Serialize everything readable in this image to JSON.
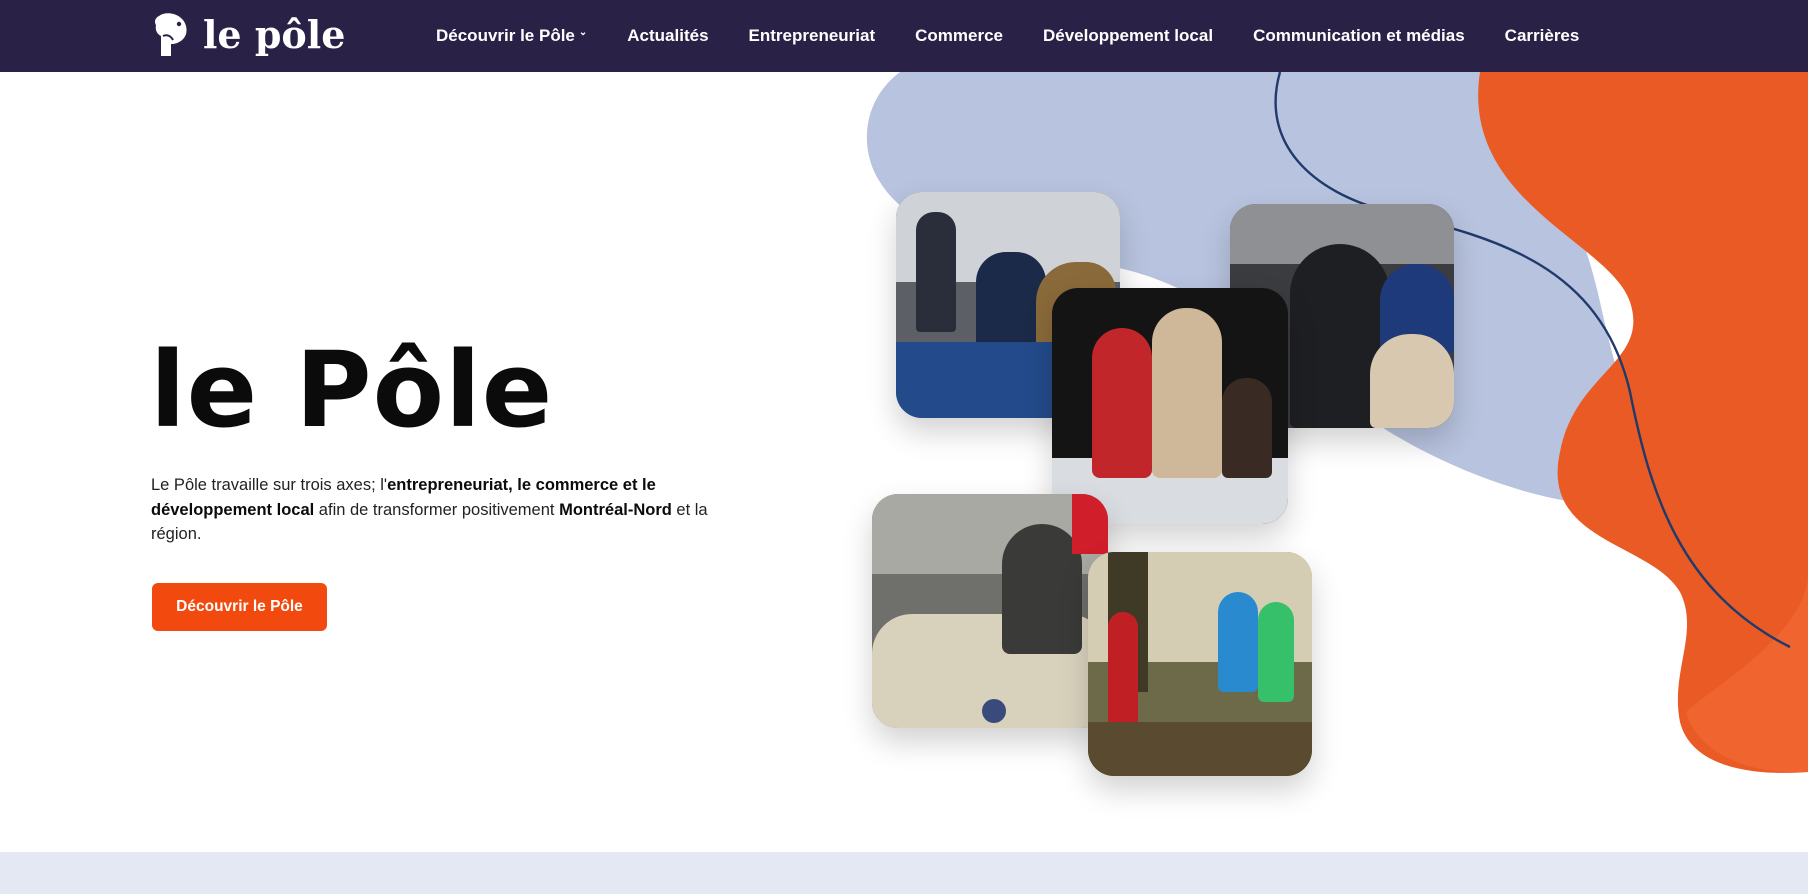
{
  "brand": {
    "name": "le pôle"
  },
  "nav": {
    "items": [
      {
        "label": "Découvrir le Pôle",
        "has_dropdown": true
      },
      {
        "label": "Actualités"
      },
      {
        "label": "Entrepreneuriat"
      },
      {
        "label": "Commerce"
      },
      {
        "label": "Développement local"
      },
      {
        "label": "Communication et médias"
      },
      {
        "label": "Carrières"
      }
    ],
    "dropdown_icon": "chevron-down-icon"
  },
  "hero": {
    "title": "le Pôle",
    "description": {
      "p1": "Le Pôle travaille sur trois axes; l'",
      "b1": "entrepreneuriat, le commerce et le développement local",
      "p2": " afin de transformer positivement ",
      "b2": "Montréal-Nord",
      "p3": " et la région."
    },
    "cta_label": "Découvrir le Pôle"
  },
  "colors": {
    "nav_bg": "#2a2146",
    "accent_orange": "#f24a0e",
    "blob_blue": "#b8c3df",
    "blob_orange": "#ea5a24",
    "band": "#e4e8f2"
  }
}
